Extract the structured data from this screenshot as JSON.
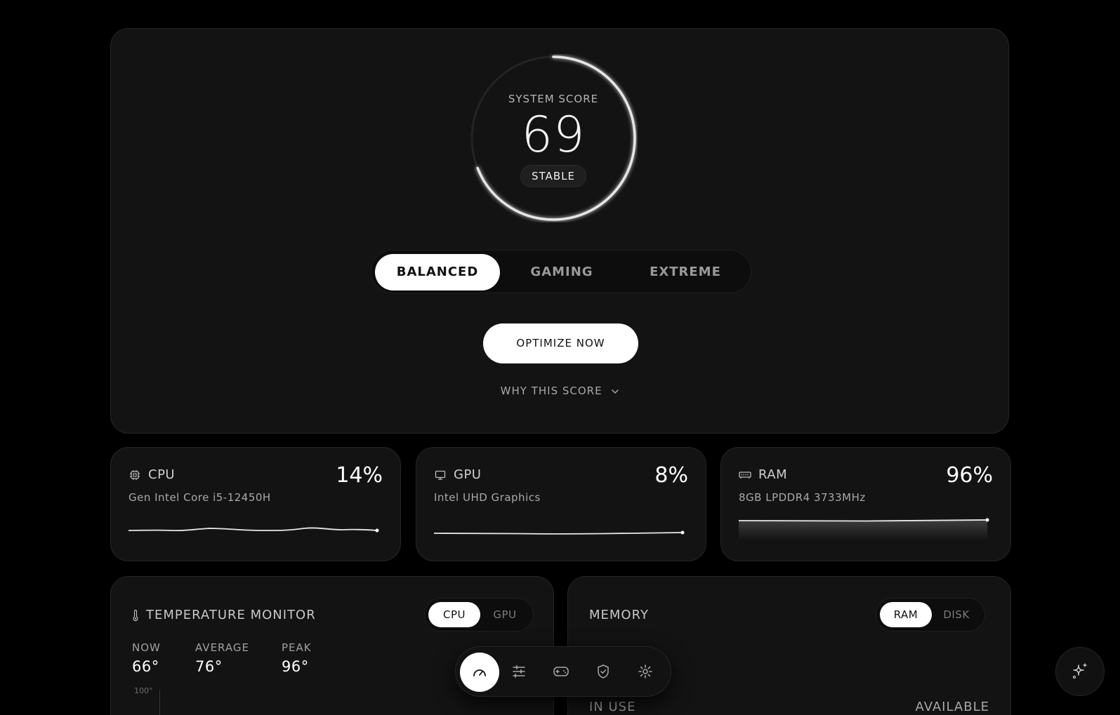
{
  "hero": {
    "score_label": "SYSTEM SCORE",
    "score": "69",
    "score_fraction": 0.69,
    "status": "STABLE",
    "modes": [
      {
        "label": "BALANCED",
        "active": true
      },
      {
        "label": "GAMING",
        "active": false
      },
      {
        "label": "EXTREME",
        "active": false
      }
    ],
    "optimize_label": "OPTIMIZE NOW",
    "why_label": "WHY THIS SCORE"
  },
  "metrics": {
    "cpu": {
      "title": "CPU",
      "value": "14%",
      "subtitle": "Gen Intel Core i5-12450H",
      "icon": "cpu-chip-icon"
    },
    "gpu": {
      "title": "GPU",
      "value": "8%",
      "subtitle": "Intel UHD Graphics",
      "icon": "monitor-icon"
    },
    "ram": {
      "title": "RAM",
      "value": "96%",
      "subtitle": "8GB LPDDR4 3733MHz",
      "icon": "memory-module-icon"
    }
  },
  "temperature": {
    "title": "TEMPERATURE MONITOR",
    "icon": "thermometer-icon",
    "toggle": [
      {
        "label": "CPU",
        "active": true
      },
      {
        "label": "GPU",
        "active": false
      }
    ],
    "stats": [
      {
        "label": "NOW",
        "value": "66°"
      },
      {
        "label": "AVERAGE",
        "value": "76°"
      },
      {
        "label": "PEAK",
        "value": "96°"
      }
    ],
    "axis_max": "100°"
  },
  "memory": {
    "title": "MEMORY",
    "toggle": [
      {
        "label": "RAM",
        "active": true
      },
      {
        "label": "DISK",
        "active": false
      }
    ],
    "in_use_label": "IN USE",
    "available_label": "AVAILABLE"
  },
  "dock": {
    "items": [
      "speedometer-icon",
      "sliders-icon",
      "gamepad-icon",
      "shield-check-icon",
      "gear-icon"
    ],
    "active_index": 0
  },
  "fab": {
    "icon": "sparkles-icon"
  },
  "colors": {
    "background": "#000000",
    "card": "#131313",
    "accent": "#ffffff"
  }
}
